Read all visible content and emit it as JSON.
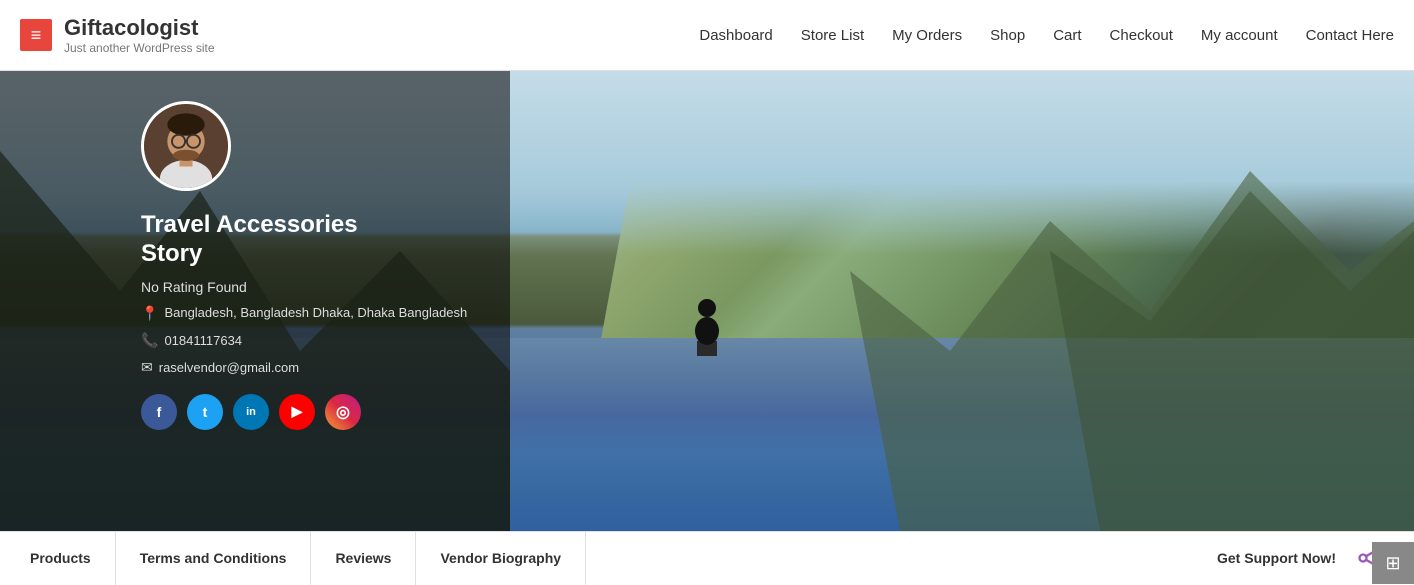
{
  "site": {
    "title": "Giftacologist",
    "tagline": "Just another WordPress site",
    "menu_icon": "≡"
  },
  "nav": {
    "items": [
      {
        "label": "Dashboard",
        "href": "#"
      },
      {
        "label": "Store List",
        "href": "#"
      },
      {
        "label": "My Orders",
        "href": "#"
      },
      {
        "label": "Shop",
        "href": "#"
      },
      {
        "label": "Cart",
        "href": "#"
      },
      {
        "label": "Checkout",
        "href": "#"
      },
      {
        "label": "My account",
        "href": "#"
      },
      {
        "label": "Contact Here",
        "href": "#"
      }
    ]
  },
  "store": {
    "name_line1": "Travel Accessories",
    "name_line2": "Story",
    "rating": "No Rating Found",
    "location": "Bangladesh, Bangladesh Dhaka, Dhaka Bangladesh",
    "phone": "01841117634",
    "email": "raselvendor@gmail.com"
  },
  "social": {
    "facebook_label": "f",
    "twitter_label": "t",
    "linkedin_label": "in",
    "youtube_label": "▶",
    "instagram_label": "📷"
  },
  "footer": {
    "nav_items": [
      {
        "label": "Products"
      },
      {
        "label": "Terms and Conditions"
      },
      {
        "label": "Reviews"
      },
      {
        "label": "Vendor Biography"
      }
    ],
    "support": "Get Support Now!",
    "share_icon": "share"
  },
  "icons": {
    "location_pin": "📍",
    "phone": "📞",
    "email": "✉"
  }
}
